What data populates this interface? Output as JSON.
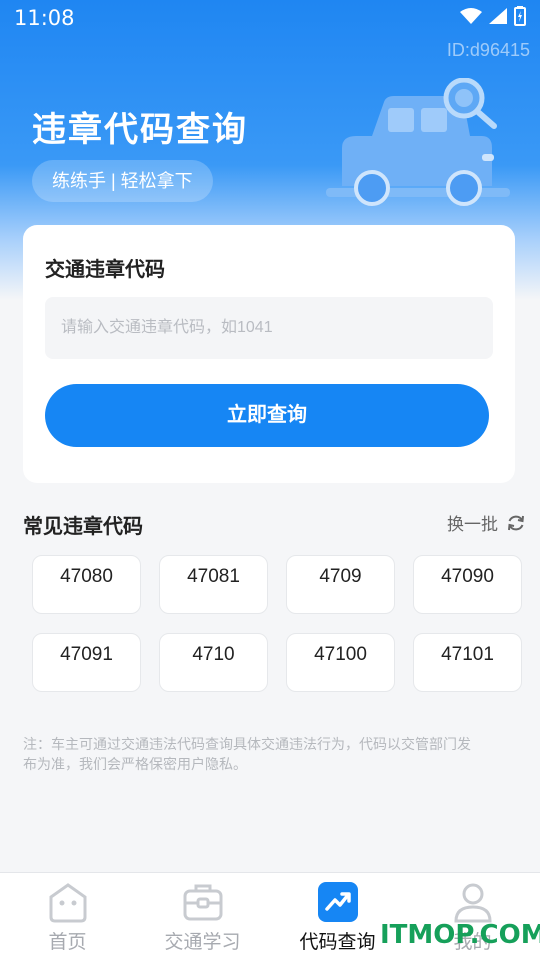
{
  "status_bar": {
    "time": "11:08"
  },
  "header": {
    "id_text": "ID:d96415",
    "title": "违章代码查询",
    "slogan": "练练手 | 轻松拿下"
  },
  "search_card": {
    "title": "交通违章代码",
    "input_placeholder": "请输入交通违章代码，如1041",
    "input_value": "",
    "submit_label": "立即查询"
  },
  "common_codes": {
    "title": "常见违章代码",
    "refresh_label": "换一批",
    "codes": [
      "47080",
      "47081",
      "4709",
      "47090",
      "47091",
      "4710",
      "47100",
      "47101"
    ]
  },
  "note": "注：车主可通过交通违法代码查询具体交通违法行为，代码以交管部门发布为准，我们会严格保密用户隐私。",
  "tabbar": {
    "items": [
      {
        "label": "首页",
        "icon": "home-icon"
      },
      {
        "label": "交通学习",
        "icon": "briefcase-icon"
      },
      {
        "label": "代码查询",
        "icon": "trend-icon",
        "active": true
      },
      {
        "label": "我的",
        "icon": "user-icon"
      }
    ]
  },
  "watermark": "ITMOP.COM",
  "colors": {
    "primary": "#1686f4",
    "watermark": "#16a05a"
  }
}
